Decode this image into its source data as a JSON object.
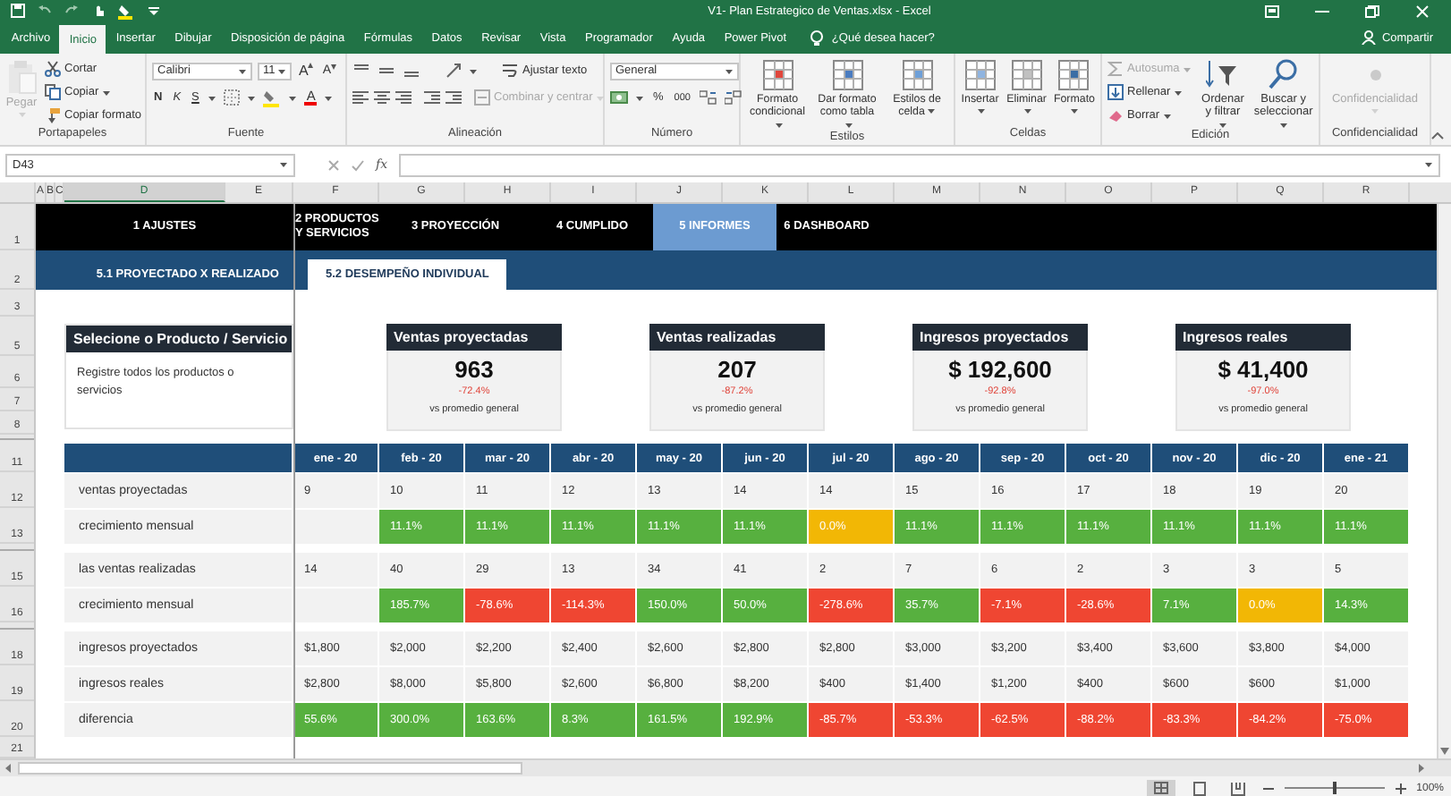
{
  "title_bar": {
    "title": "V1- Plan Estrategico de Ventas.xlsx  -  Excel"
  },
  "ribbon_tabs": {
    "items": [
      {
        "label": "Archivo",
        "selected": false
      },
      {
        "label": "Inicio",
        "selected": true
      },
      {
        "label": "Insertar",
        "selected": false
      },
      {
        "label": "Dibujar",
        "selected": false
      },
      {
        "label": "Disposición de página",
        "selected": false
      },
      {
        "label": "Fórmulas",
        "selected": false
      },
      {
        "label": "Datos",
        "selected": false
      },
      {
        "label": "Revisar",
        "selected": false
      },
      {
        "label": "Vista",
        "selected": false
      },
      {
        "label": "Programador",
        "selected": false
      },
      {
        "label": "Ayuda",
        "selected": false
      },
      {
        "label": "Power Pivot",
        "selected": false
      }
    ],
    "search": "¿Qué desea hacer?",
    "share": "Compartir"
  },
  "ribbon": {
    "groups": [
      {
        "kind": "clipboard",
        "label": "Portapapeles",
        "paste": {
          "label": "Pegar",
          "disabled": true
        },
        "actions": [
          "Cortar",
          "Copiar",
          "Copiar formato"
        ]
      },
      {
        "kind": "font",
        "label": "Fuente",
        "font": "Calibri",
        "size": "11",
        "grow": "A",
        "shrink": "A",
        "styles": [
          "N",
          "K",
          "S"
        ],
        "color_letter": "A"
      },
      {
        "kind": "alignment",
        "label": "Alineación",
        "wrap": {
          "label": "Ajustar texto",
          "disabled": false
        },
        "merge": {
          "label": "Combinar y centrar",
          "disabled": true
        }
      },
      {
        "kind": "number",
        "label": "Número",
        "format": "General",
        "percent": "%",
        "thousands": "000"
      },
      {
        "kind": "styles",
        "label": "Estilos",
        "buttons": [
          "Formato condicional",
          "Dar formato como tabla",
          "Estilos de celda"
        ]
      },
      {
        "kind": "cells",
        "label": "Celdas",
        "buttons": [
          "Insertar",
          "Eliminar",
          "Formato"
        ]
      },
      {
        "kind": "editing",
        "label": "Edición",
        "small": [
          {
            "label": "Autosuma",
            "disabled": true
          },
          {
            "label": "Rellenar",
            "disabled": false
          },
          {
            "label": "Borrar",
            "disabled": false
          }
        ],
        "big": [
          "Ordenar y filtrar",
          "Buscar y seleccionar"
        ]
      },
      {
        "kind": "sensitivity",
        "label": "Confidencialidad",
        "button": {
          "label": "Confidencialidad",
          "disabled": true
        }
      }
    ]
  },
  "formula_bar": {
    "name_box": "D43",
    "function_label": "fx"
  },
  "column_headers": [
    "A",
    "B",
    "C",
    "D",
    "E",
    "F",
    "G",
    "H",
    "I",
    "J",
    "K",
    "L",
    "M",
    "N",
    "O",
    "P",
    "Q",
    "R"
  ],
  "row_numbers": [
    "1",
    "2",
    "3",
    "5",
    "6",
    "7",
    "8",
    "11",
    "12",
    "13",
    "15",
    "16",
    "18",
    "19",
    "20",
    "21"
  ],
  "nav": {
    "items": [
      {
        "label": "1 AJUSTES",
        "selected": false
      },
      {
        "label": "2 PRODUCTOS Y SERVICIOS",
        "selected": false
      },
      {
        "label": "3 PROYECCIÓN",
        "selected": false
      },
      {
        "label": "4 CUMPLIDO",
        "selected": false
      },
      {
        "label": "5 INFORMES",
        "selected": true
      },
      {
        "label": "6 DASHBOARD",
        "selected": false
      }
    ]
  },
  "subnav": {
    "items": [
      {
        "label": "5.1 PROYECTADO X REALIZADO",
        "selected": false
      },
      {
        "label": "5.2 DESEMPEÑO INDIVIDUAL",
        "selected": true
      }
    ]
  },
  "selector": {
    "title": "Selecione o Producto / Servicio",
    "hint": "Registre todos los productos o servicios"
  },
  "kpis": [
    {
      "title": "Ventas proyectadas",
      "value": "963",
      "change": "-72.4%",
      "note": "vs promedio general"
    },
    {
      "title": "Ventas realizadas",
      "value": "207",
      "change": "-87.2%",
      "note": "vs promedio general"
    },
    {
      "title": "Ingresos proyectados",
      "value": "$ 192,600",
      "change": "-92.8%",
      "note": "vs promedio general"
    },
    {
      "title": "Ingresos reales",
      "value": "$ 41,400",
      "change": "-97.0%",
      "note": "vs promedio general"
    }
  ],
  "table": {
    "months": [
      "ene - 20",
      "feb - 20",
      "mar - 20",
      "abr - 20",
      "may - 20",
      "jun - 20",
      "jul - 20",
      "ago - 20",
      "sep - 20",
      "oct - 20",
      "nov - 20",
      "dic - 20",
      "ene - 21"
    ],
    "groups": [
      {
        "rows": [
          {
            "label": "ventas proyectadas",
            "cells": [
              {
                "text": "9"
              },
              {
                "text": "10"
              },
              {
                "text": "11"
              },
              {
                "text": "12"
              },
              {
                "text": "13"
              },
              {
                "text": "14"
              },
              {
                "text": "14"
              },
              {
                "text": "15"
              },
              {
                "text": "16"
              },
              {
                "text": "17"
              },
              {
                "text": "18"
              },
              {
                "text": "19"
              },
              {
                "text": "20"
              }
            ]
          },
          {
            "label": "crecimiento mensual",
            "cells": [
              null,
              {
                "text": "11.1%",
                "color": "#57b03f"
              },
              {
                "text": "11.1%",
                "color": "#57b03f"
              },
              {
                "text": "11.1%",
                "color": "#57b03f"
              },
              {
                "text": "11.1%",
                "color": "#57b03f"
              },
              {
                "text": "11.1%",
                "color": "#57b03f"
              },
              {
                "text": "0.0%",
                "color": "#f2b705"
              },
              {
                "text": "11.1%",
                "color": "#57b03f"
              },
              {
                "text": "11.1%",
                "color": "#57b03f"
              },
              {
                "text": "11.1%",
                "color": "#57b03f"
              },
              {
                "text": "11.1%",
                "color": "#57b03f"
              },
              {
                "text": "11.1%",
                "color": "#57b03f"
              },
              {
                "text": "11.1%",
                "color": "#57b03f"
              }
            ]
          }
        ]
      },
      {
        "rows": [
          {
            "label": "las ventas realizadas",
            "cells": [
              {
                "text": "14"
              },
              {
                "text": "40"
              },
              {
                "text": "29"
              },
              {
                "text": "13"
              },
              {
                "text": "34"
              },
              {
                "text": "41"
              },
              {
                "text": "2"
              },
              {
                "text": "7"
              },
              {
                "text": "6"
              },
              {
                "text": "2"
              },
              {
                "text": "3"
              },
              {
                "text": "3"
              },
              {
                "text": "5"
              }
            ]
          },
          {
            "label": "crecimiento mensual",
            "cells": [
              null,
              {
                "text": "185.7%",
                "color": "#57b03f"
              },
              {
                "text": "-78.6%",
                "color": "#ef4632"
              },
              {
                "text": "-114.3%",
                "color": "#ef4632"
              },
              {
                "text": "150.0%",
                "color": "#57b03f"
              },
              {
                "text": "50.0%",
                "color": "#57b03f"
              },
              {
                "text": "-278.6%",
                "color": "#ef4632"
              },
              {
                "text": "35.7%",
                "color": "#57b03f"
              },
              {
                "text": "-7.1%",
                "color": "#ef4632"
              },
              {
                "text": "-28.6%",
                "color": "#ef4632"
              },
              {
                "text": "7.1%",
                "color": "#57b03f"
              },
              {
                "text": "0.0%",
                "color": "#f2b705"
              },
              {
                "text": "14.3%",
                "color": "#57b03f"
              }
            ]
          }
        ]
      },
      {
        "rows": [
          {
            "label": "ingresos proyectados",
            "cells": [
              {
                "text": "$1,800"
              },
              {
                "text": "$2,000"
              },
              {
                "text": "$2,200"
              },
              {
                "text": "$2,400"
              },
              {
                "text": "$2,600"
              },
              {
                "text": "$2,800"
              },
              {
                "text": "$2,800"
              },
              {
                "text": "$3,000"
              },
              {
                "text": "$3,200"
              },
              {
                "text": "$3,400"
              },
              {
                "text": "$3,600"
              },
              {
                "text": "$3,800"
              },
              {
                "text": "$4,000"
              }
            ]
          },
          {
            "label": "ingresos reales",
            "cells": [
              {
                "text": "$2,800"
              },
              {
                "text": "$8,000"
              },
              {
                "text": "$5,800"
              },
              {
                "text": "$2,600"
              },
              {
                "text": "$6,800"
              },
              {
                "text": "$8,200"
              },
              {
                "text": "$400"
              },
              {
                "text": "$1,400"
              },
              {
                "text": "$1,200"
              },
              {
                "text": "$400"
              },
              {
                "text": "$600"
              },
              {
                "text": "$600"
              },
              {
                "text": "$1,000"
              }
            ]
          },
          {
            "label": "diferencia",
            "cells": [
              {
                "text": "55.6%",
                "color": "#57b03f"
              },
              {
                "text": "300.0%",
                "color": "#57b03f"
              },
              {
                "text": "163.6%",
                "color": "#57b03f"
              },
              {
                "text": "8.3%",
                "color": "#57b03f"
              },
              {
                "text": "161.5%",
                "color": "#57b03f"
              },
              {
                "text": "192.9%",
                "color": "#57b03f"
              },
              {
                "text": "-85.7%",
                "color": "#ef4632"
              },
              {
                "text": "-53.3%",
                "color": "#ef4632"
              },
              {
                "text": "-62.5%",
                "color": "#ef4632"
              },
              {
                "text": "-88.2%",
                "color": "#ef4632"
              },
              {
                "text": "-83.3%",
                "color": "#ef4632"
              },
              {
                "text": "-84.2%",
                "color": "#ef4632"
              },
              {
                "text": "-75.0%",
                "color": "#ef4632"
              }
            ]
          }
        ]
      }
    ]
  },
  "status_bar": {
    "views": [
      {
        "kind": "normal",
        "selected": true
      },
      {
        "kind": "page_layout",
        "selected": false
      },
      {
        "kind": "page_break",
        "selected": false
      }
    ],
    "zoom": {
      "level": 0.5,
      "reading": "100%"
    }
  }
}
